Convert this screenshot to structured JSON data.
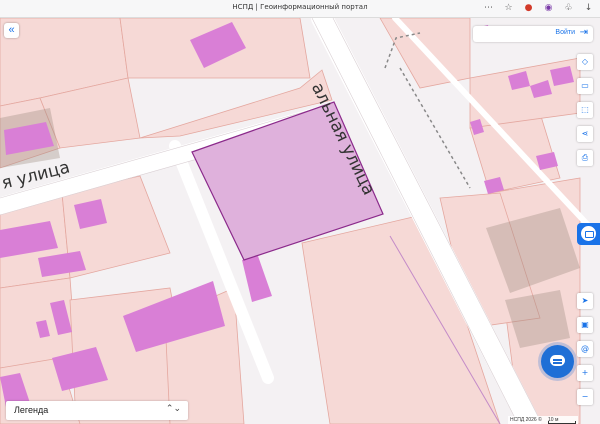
{
  "browser": {
    "tab_title": "НСПД | Геоинформационный портал",
    "icons": [
      "more-icon",
      "bookmark-star-icon",
      "profile-icon",
      "extension-icon",
      "puzzle-icon",
      "download-icon"
    ]
  },
  "map": {
    "street_labels": [
      "я улица",
      "альная улица"
    ],
    "colors": {
      "background": "#f4f1f3",
      "parcel_fill": "#f6d9d6",
      "parcel_border": "#e4a79f",
      "building_fill": "#d97fd6",
      "selected_fill": "#dfb1dc",
      "selected_border": "#8b2a8b",
      "road": "#ffffff",
      "zone_fill": "#9c8a7e"
    }
  },
  "controls": {
    "collapse_icon": "«",
    "login_label": "Войти",
    "top_tools": [
      {
        "name": "layers-icon",
        "glyph": "◇"
      },
      {
        "name": "basemap-icon",
        "glyph": "▭"
      },
      {
        "name": "select-area-icon",
        "glyph": "⬚"
      },
      {
        "name": "share-icon",
        "glyph": "⋖"
      },
      {
        "name": "print-icon",
        "glyph": "⎙"
      }
    ],
    "bottom_tools": [
      {
        "name": "locate-icon",
        "glyph": "➤"
      },
      {
        "name": "screen-icon",
        "glyph": "▣"
      },
      {
        "name": "address-icon",
        "glyph": "@"
      },
      {
        "name": "zoom-in-icon",
        "glyph": "+"
      },
      {
        "name": "zoom-out-icon",
        "glyph": "−"
      }
    ]
  },
  "legend": {
    "label": "Легенда",
    "arrow": "⌃⌄"
  },
  "scale": {
    "text": "НСПД 2026 ©",
    "value": "10 м"
  }
}
